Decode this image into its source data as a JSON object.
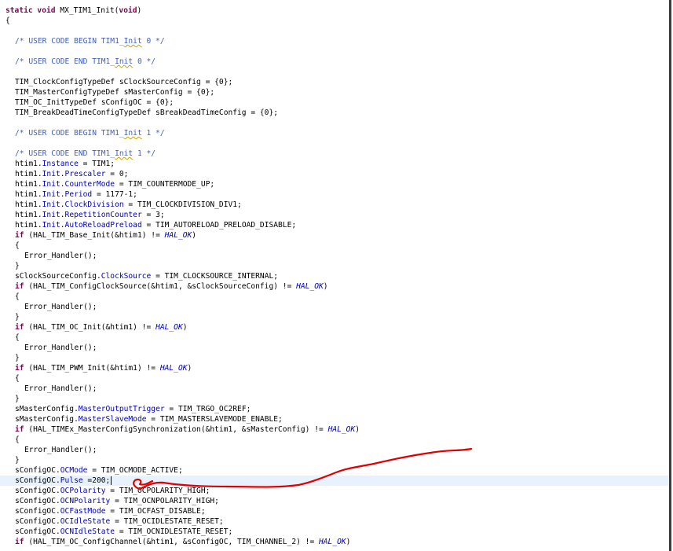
{
  "editor": {
    "colors": {
      "keyword": "#7f0055",
      "comment": "#3f5fbf",
      "field": "#0000c0",
      "macro": "#0000c0",
      "current_line": "#e8f2fe",
      "annotation": "#e00000"
    },
    "lines": [
      {
        "indent": 0,
        "tokens": [
          {
            "t": "static void",
            "c": "kw"
          },
          {
            "t": " MX_TIM1_Init("
          },
          {
            "t": "void",
            "c": "kw"
          },
          {
            "t": ")"
          }
        ]
      },
      {
        "indent": 0,
        "tokens": [
          {
            "t": "{"
          }
        ]
      },
      {
        "indent": 0,
        "tokens": []
      },
      {
        "indent": 1,
        "tokens": [
          {
            "t": "/* USER CODE BEGIN TIM1_",
            "c": "cm"
          },
          {
            "t": "Init",
            "c": "cm typo"
          },
          {
            "t": " 0 */",
            "c": "cm"
          }
        ]
      },
      {
        "indent": 0,
        "tokens": []
      },
      {
        "indent": 1,
        "tokens": [
          {
            "t": "/* USER CODE END TIM1_",
            "c": "cm"
          },
          {
            "t": "Init",
            "c": "cm typo"
          },
          {
            "t": " 0 */",
            "c": "cm"
          }
        ]
      },
      {
        "indent": 0,
        "tokens": []
      },
      {
        "indent": 1,
        "tokens": [
          {
            "t": "TIM_ClockConfigTypeDef sClockSourceConfig = {0};"
          }
        ]
      },
      {
        "indent": 1,
        "tokens": [
          {
            "t": "TIM_MasterConfigTypeDef sMasterConfig = {0};"
          }
        ]
      },
      {
        "indent": 1,
        "tokens": [
          {
            "t": "TIM_OC_InitTypeDef sConfigOC = {0};"
          }
        ]
      },
      {
        "indent": 1,
        "tokens": [
          {
            "t": "TIM_BreakDeadTimeConfigTypeDef sBreakDeadTimeConfig = {0};"
          }
        ]
      },
      {
        "indent": 0,
        "tokens": []
      },
      {
        "indent": 1,
        "tokens": [
          {
            "t": "/* USER CODE BEGIN TIM1_",
            "c": "cm"
          },
          {
            "t": "Init",
            "c": "cm typo"
          },
          {
            "t": " 1 */",
            "c": "cm"
          }
        ]
      },
      {
        "indent": 0,
        "tokens": []
      },
      {
        "indent": 1,
        "tokens": [
          {
            "t": "/* USER CODE END TIM1_",
            "c": "cm"
          },
          {
            "t": "Init",
            "c": "cm typo"
          },
          {
            "t": " 1 */",
            "c": "cm"
          }
        ]
      },
      {
        "indent": 1,
        "tokens": [
          {
            "t": "htim1."
          },
          {
            "t": "Instance",
            "c": "fd"
          },
          {
            "t": " = TIM1;"
          }
        ]
      },
      {
        "indent": 1,
        "tokens": [
          {
            "t": "htim1."
          },
          {
            "t": "Init",
            "c": "fd"
          },
          {
            "t": "."
          },
          {
            "t": "Prescaler",
            "c": "fd"
          },
          {
            "t": " = 0;"
          }
        ]
      },
      {
        "indent": 1,
        "tokens": [
          {
            "t": "htim1."
          },
          {
            "t": "Init",
            "c": "fd"
          },
          {
            "t": "."
          },
          {
            "t": "CounterMode",
            "c": "fd"
          },
          {
            "t": " = TIM_COUNTERMODE_UP;"
          }
        ]
      },
      {
        "indent": 1,
        "tokens": [
          {
            "t": "htim1."
          },
          {
            "t": "Init",
            "c": "fd"
          },
          {
            "t": "."
          },
          {
            "t": "Period",
            "c": "fd"
          },
          {
            "t": " = 1177-1;"
          }
        ]
      },
      {
        "indent": 1,
        "tokens": [
          {
            "t": "htim1."
          },
          {
            "t": "Init",
            "c": "fd"
          },
          {
            "t": "."
          },
          {
            "t": "ClockDivision",
            "c": "fd"
          },
          {
            "t": " = TIM_CLOCKDIVISION_DIV1;"
          }
        ]
      },
      {
        "indent": 1,
        "tokens": [
          {
            "t": "htim1."
          },
          {
            "t": "Init",
            "c": "fd"
          },
          {
            "t": "."
          },
          {
            "t": "RepetitionCounter",
            "c": "fd"
          },
          {
            "t": " = 3;"
          }
        ]
      },
      {
        "indent": 1,
        "tokens": [
          {
            "t": "htim1."
          },
          {
            "t": "Init",
            "c": "fd"
          },
          {
            "t": "."
          },
          {
            "t": "AutoReloadPreload",
            "c": "fd"
          },
          {
            "t": " = TIM_AUTORELOAD_PRELOAD_DISABLE;"
          }
        ]
      },
      {
        "indent": 1,
        "tokens": [
          {
            "t": "if",
            "c": "kw"
          },
          {
            "t": " (HAL_TIM_Base_Init(&htim1) != "
          },
          {
            "t": "HAL_OK",
            "c": "mc"
          },
          {
            "t": ")"
          }
        ]
      },
      {
        "indent": 1,
        "tokens": [
          {
            "t": "{"
          }
        ]
      },
      {
        "indent": 2,
        "tokens": [
          {
            "t": "Error_Handler();"
          }
        ]
      },
      {
        "indent": 1,
        "tokens": [
          {
            "t": "}"
          }
        ]
      },
      {
        "indent": 1,
        "tokens": [
          {
            "t": "sClockSourceConfig."
          },
          {
            "t": "ClockSource",
            "c": "fd"
          },
          {
            "t": " = TIM_CLOCKSOURCE_INTERNAL;"
          }
        ]
      },
      {
        "indent": 1,
        "tokens": [
          {
            "t": "if",
            "c": "kw"
          },
          {
            "t": " (HAL_TIM_ConfigClockSource(&htim1, &sClockSourceConfig) != "
          },
          {
            "t": "HAL_OK",
            "c": "mc"
          },
          {
            "t": ")"
          }
        ]
      },
      {
        "indent": 1,
        "tokens": [
          {
            "t": "{"
          }
        ]
      },
      {
        "indent": 2,
        "tokens": [
          {
            "t": "Error_Handler();"
          }
        ]
      },
      {
        "indent": 1,
        "tokens": [
          {
            "t": "}"
          }
        ]
      },
      {
        "indent": 1,
        "tokens": [
          {
            "t": "if",
            "c": "kw"
          },
          {
            "t": " (HAL_TIM_OC_Init(&htim1) != "
          },
          {
            "t": "HAL_OK",
            "c": "mc"
          },
          {
            "t": ")"
          }
        ]
      },
      {
        "indent": 1,
        "tokens": [
          {
            "t": "{"
          }
        ]
      },
      {
        "indent": 2,
        "tokens": [
          {
            "t": "Error_Handler();"
          }
        ]
      },
      {
        "indent": 1,
        "tokens": [
          {
            "t": "}"
          }
        ]
      },
      {
        "indent": 1,
        "tokens": [
          {
            "t": "if",
            "c": "kw"
          },
          {
            "t": " (HAL_TIM_PWM_Init(&htim1) != "
          },
          {
            "t": "HAL_OK",
            "c": "mc"
          },
          {
            "t": ")"
          }
        ]
      },
      {
        "indent": 1,
        "tokens": [
          {
            "t": "{"
          }
        ]
      },
      {
        "indent": 2,
        "tokens": [
          {
            "t": "Error_Handler();"
          }
        ]
      },
      {
        "indent": 1,
        "tokens": [
          {
            "t": "}"
          }
        ]
      },
      {
        "indent": 1,
        "tokens": [
          {
            "t": "sMasterConfig."
          },
          {
            "t": "MasterOutputTrigger",
            "c": "fd"
          },
          {
            "t": " = TIM_TRGO_OC2REF;"
          }
        ]
      },
      {
        "indent": 1,
        "tokens": [
          {
            "t": "sMasterConfig."
          },
          {
            "t": "MasterSlaveMode",
            "c": "fd"
          },
          {
            "t": " = TIM_MASTERSLAVEMODE_ENABLE;"
          }
        ]
      },
      {
        "indent": 1,
        "tokens": [
          {
            "t": "if",
            "c": "kw"
          },
          {
            "t": " (HAL_TIMEx_MasterConfigSynchronization(&htim1, &sMasterConfig) != "
          },
          {
            "t": "HAL_OK",
            "c": "mc"
          },
          {
            "t": ")"
          }
        ]
      },
      {
        "indent": 1,
        "tokens": [
          {
            "t": "{"
          }
        ]
      },
      {
        "indent": 2,
        "tokens": [
          {
            "t": "Error_Handler();"
          }
        ]
      },
      {
        "indent": 1,
        "tokens": [
          {
            "t": "}"
          }
        ]
      },
      {
        "indent": 1,
        "tokens": [
          {
            "t": "sConfigOC."
          },
          {
            "t": "OCMode",
            "c": "fd"
          },
          {
            "t": " = TIM_OCMODE_ACTIVE;"
          }
        ]
      },
      {
        "indent": 1,
        "current": true,
        "tokens": [
          {
            "t": "sConfigOC."
          },
          {
            "t": "Pulse",
            "c": "fd"
          },
          {
            "t": " =200;"
          }
        ]
      },
      {
        "indent": 1,
        "tokens": [
          {
            "t": "sConfigOC."
          },
          {
            "t": "OCPolarity",
            "c": "fd"
          },
          {
            "t": " = TIM_OCPOLARITY_HIGH;"
          }
        ]
      },
      {
        "indent": 1,
        "tokens": [
          {
            "t": "sConfigOC."
          },
          {
            "t": "OCNPolarity",
            "c": "fd"
          },
          {
            "t": " = TIM_OCNPOLARITY_HIGH;"
          }
        ]
      },
      {
        "indent": 1,
        "tokens": [
          {
            "t": "sConfigOC."
          },
          {
            "t": "OCFastMode",
            "c": "fd"
          },
          {
            "t": " = TIM_OCFAST_DISABLE;"
          }
        ]
      },
      {
        "indent": 1,
        "tokens": [
          {
            "t": "sConfigOC."
          },
          {
            "t": "OCIdleState",
            "c": "fd"
          },
          {
            "t": " = TIM_OCIDLESTATE_RESET;"
          }
        ]
      },
      {
        "indent": 1,
        "tokens": [
          {
            "t": "sConfigOC."
          },
          {
            "t": "OCNIdleState",
            "c": "fd"
          },
          {
            "t": " = TIM_OCNIDLESTATE_RESET;"
          }
        ]
      },
      {
        "indent": 1,
        "tokens": [
          {
            "t": "if",
            "c": "kw"
          },
          {
            "t": " (HAL_TIM_OC_ConfigChannel(&htim1, &sConfigOC, TIM_CHANNEL_2) != "
          },
          {
            "t": "HAL_OK",
            "c": "mc"
          },
          {
            "t": ")"
          }
        ]
      }
    ]
  }
}
